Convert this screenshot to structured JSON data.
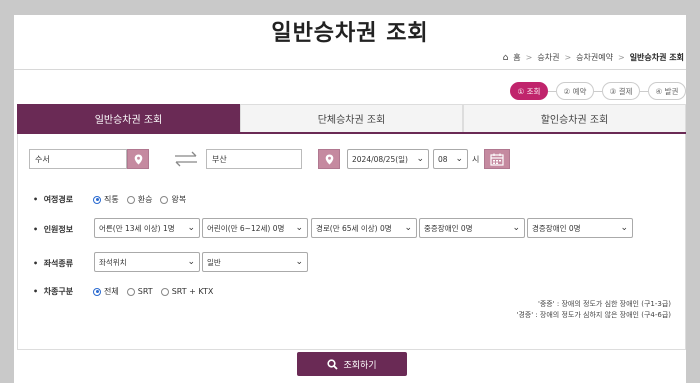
{
  "page": {
    "title": "일반승차권 조회"
  },
  "breadcrumb": {
    "home": "홈",
    "level1": "승차권",
    "level2": "승차권예약",
    "current": "일반승차권 조회"
  },
  "steps": [
    "① 조회",
    "② 예약",
    "③ 결제",
    "④ 발권"
  ],
  "tabs": [
    "일반승차권 조회",
    "단체승차권 조회",
    "할인승차권 조회"
  ],
  "route": {
    "departure": "수서",
    "arrival": "부산",
    "date": "2024/08/25(일)",
    "hour": "08",
    "hour_unit": "시"
  },
  "trip_type": {
    "label": "여정경로",
    "options": [
      "직통",
      "환승",
      "왕복"
    ],
    "selected": "직통"
  },
  "passengers": {
    "label": "인원정보",
    "adult": "어른(만 13세 이상) 1명",
    "child": "어린이(만 6~12세) 0명",
    "senior": "경로(만 65세 이상) 0명",
    "severe_disabled": "중증장애인 0명",
    "mild_disabled": "경증장애인 0명"
  },
  "seat": {
    "label": "좌석종류",
    "position": "좌석위치",
    "type": "일반"
  },
  "car_type": {
    "label": "차종구분",
    "options": [
      "전체",
      "SRT",
      "SRT + KTX"
    ],
    "selected": "전체"
  },
  "notes": {
    "severe": "'중증' : 장애의 정도가 심한 장애인 (구1-3급)",
    "mild": "'경증' : 장애의 정도가 심하지 않은 장애인 (구4-6급)"
  },
  "search_button": "조회하기",
  "colors": {
    "brand": "#6a2a55",
    "step_active": "#c0246c",
    "pin": "#c58aa0"
  },
  "icons": {
    "home": "home-icon",
    "pin": "map-pin-icon",
    "swap": "swap-arrows-icon",
    "calendar": "calendar-icon",
    "search": "search-icon"
  }
}
